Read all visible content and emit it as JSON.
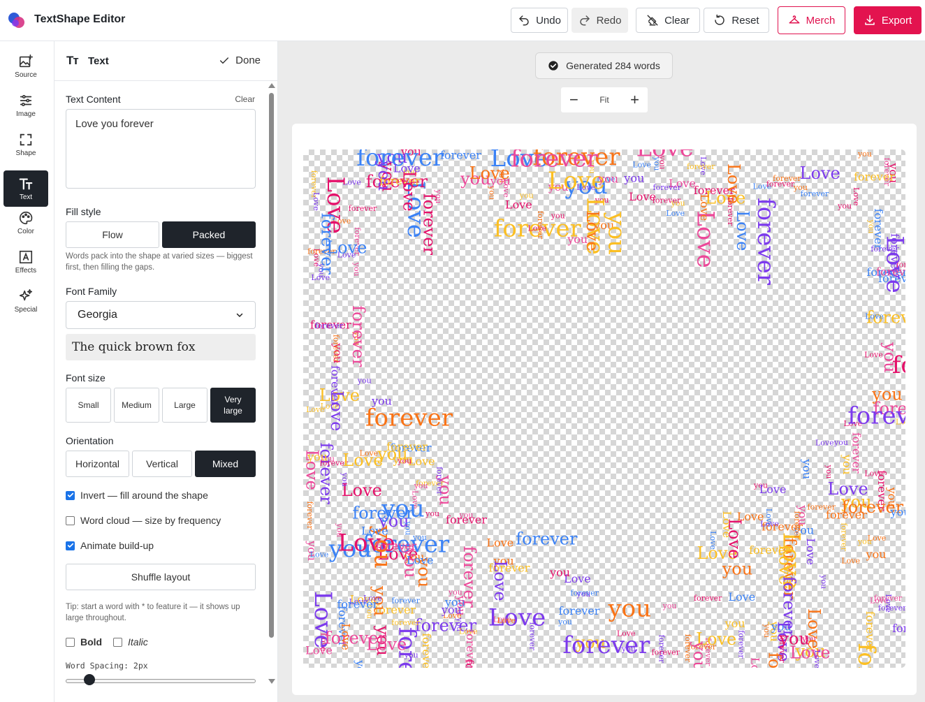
{
  "app": {
    "title": "TextShape Editor"
  },
  "toolbar": {
    "undo": "Undo",
    "redo": "Redo",
    "clear": "Clear",
    "reset": "Reset",
    "merch": "Merch",
    "export": "Export",
    "accent": "#e3134f"
  },
  "rail": {
    "items": [
      {
        "label": "Source",
        "icon": "image-plus-icon"
      },
      {
        "label": "Image",
        "icon": "sliders-icon"
      },
      {
        "label": "Shape",
        "icon": "frame-corners-icon"
      },
      {
        "label": "Text",
        "icon": "text-size-icon"
      },
      {
        "label": "Color",
        "icon": "palette-icon"
      },
      {
        "label": "Effects",
        "icon": "text-frame-icon"
      },
      {
        "label": "Special",
        "icon": "sparkles-icon"
      }
    ],
    "active": "Text"
  },
  "panel": {
    "title": "Text",
    "done": "Done",
    "text_content_label": "Text Content",
    "clear": "Clear",
    "text_content_value": "Love you forever",
    "fill_style_label": "Fill style",
    "fill_style_options": [
      "Flow",
      "Packed"
    ],
    "fill_style_selected": "Packed",
    "fill_style_hint": "Words pack into the shape at varied sizes — biggest first, then filling the gaps.",
    "font_family_label": "Font Family",
    "font_family_value": "Georgia",
    "font_preview": "The quick brown fox",
    "font_size_label": "Font size",
    "font_size_options": [
      "Small",
      "Medium",
      "Large",
      "Very large"
    ],
    "font_size_selected": "Very large",
    "orientation_label": "Orientation",
    "orientation_options": [
      "Horizontal",
      "Vertical",
      "Mixed"
    ],
    "orientation_selected": "Mixed",
    "invert_label": "Invert — fill around the shape",
    "invert_checked": true,
    "word_cloud_label": "Word cloud — size by frequency",
    "word_cloud_checked": false,
    "animate_label": "Animate build-up",
    "animate_checked": true,
    "shuffle_label": "Shuffle layout",
    "tip": "Tip: start a word with * to feature it — it shows up large throughout.",
    "bold_label": "Bold",
    "bold_checked": false,
    "italic_label": "Italic",
    "italic_checked": false,
    "word_spacing_label": "Word Spacing: 2px",
    "word_spacing_value": 2
  },
  "workspace": {
    "status": "Generated 284 words",
    "zoom_fit": "Fit",
    "words": [
      "Love",
      "you",
      "forever"
    ],
    "palette": [
      "#e5106a",
      "#7c3aed",
      "#3b82f6",
      "#f97316",
      "#fbbf24",
      "#ec4899"
    ]
  }
}
